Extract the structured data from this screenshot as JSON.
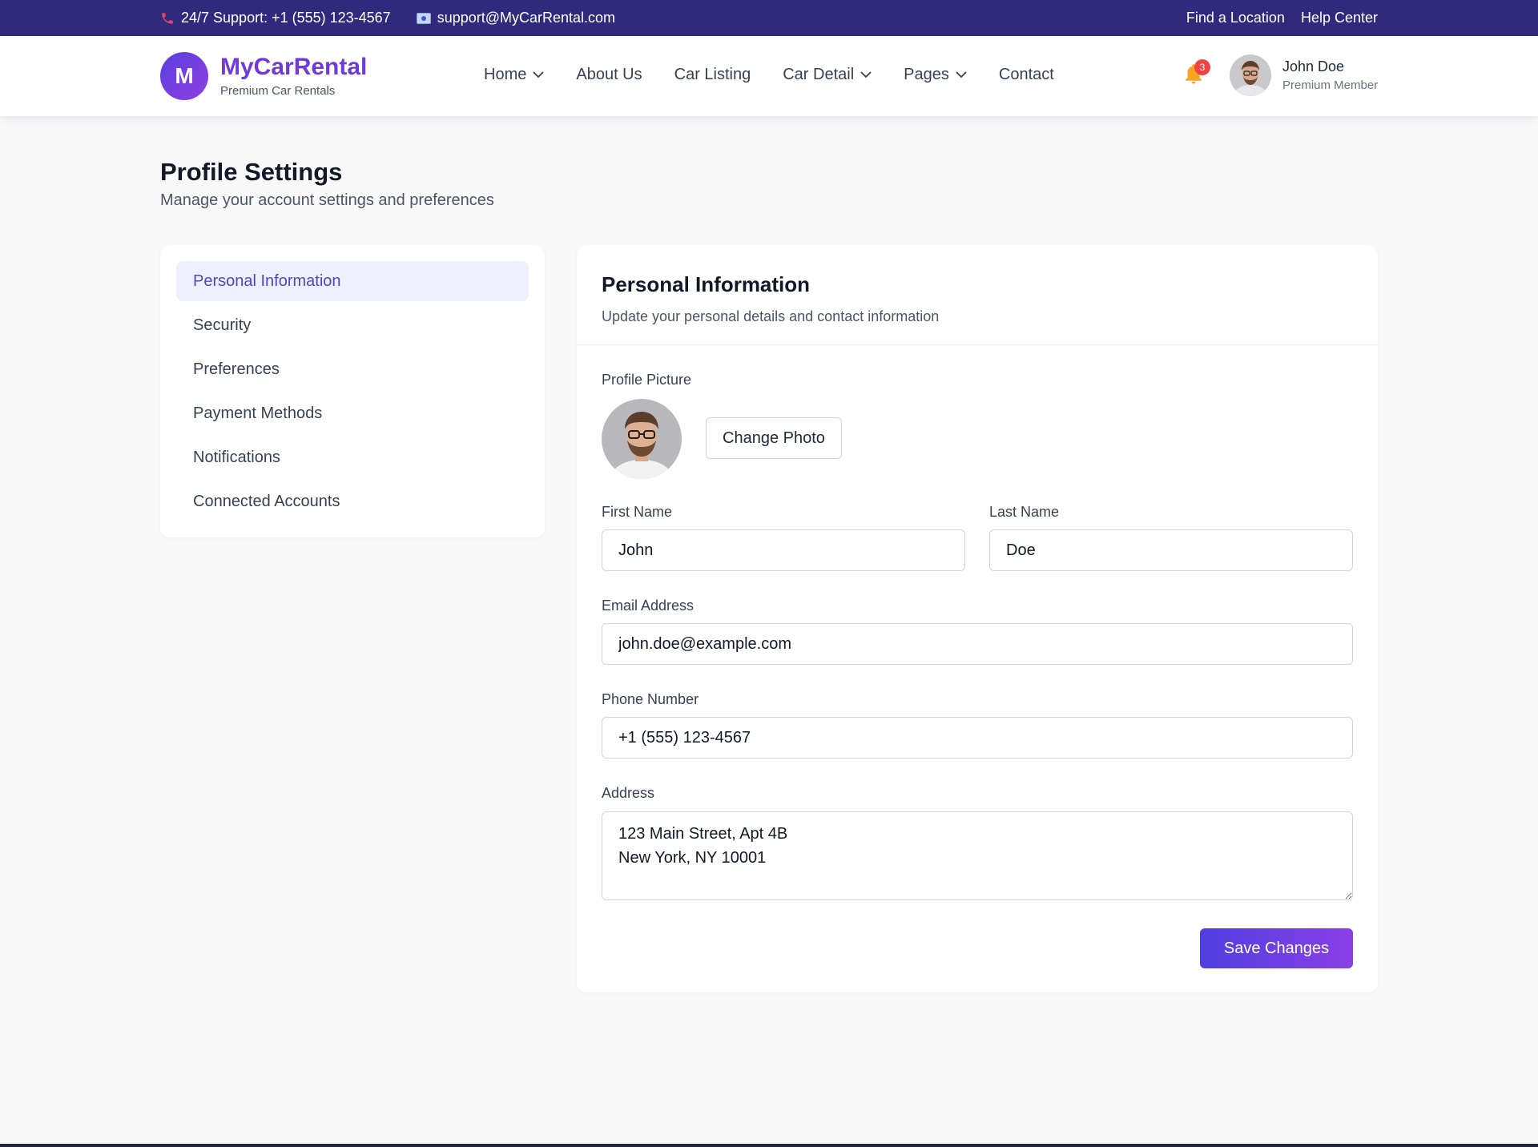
{
  "topbar": {
    "support_text": "24/7 Support: +1 (555) 123-4567",
    "email_text": "support@MyCarRental.com",
    "links": [
      "Find a Location",
      "Help Center"
    ],
    "phone_icon": "phone-icon",
    "mail_icon": "mail-icon"
  },
  "header": {
    "logo_letter": "M",
    "brand_name": "MyCarRental",
    "brand_tagline": "Premium Car Rentals",
    "nav": [
      {
        "label": "Home",
        "dropdown": true
      },
      {
        "label": "About Us",
        "dropdown": false
      },
      {
        "label": "Car Listing",
        "dropdown": false
      },
      {
        "label": "Car Detail",
        "dropdown": true
      },
      {
        "label": "Pages",
        "dropdown": true
      },
      {
        "label": "Contact",
        "dropdown": false
      }
    ],
    "notification_count": "3",
    "user_name": "John Doe",
    "user_role": "Premium Member"
  },
  "page": {
    "title": "Profile Settings",
    "subtitle": "Manage your account settings and preferences"
  },
  "sidebar": {
    "items": [
      {
        "label": "Personal Information",
        "active": true
      },
      {
        "label": "Security",
        "active": false
      },
      {
        "label": "Preferences",
        "active": false
      },
      {
        "label": "Payment Methods",
        "active": false
      },
      {
        "label": "Notifications",
        "active": false
      },
      {
        "label": "Connected Accounts",
        "active": false
      }
    ]
  },
  "form": {
    "title": "Personal Information",
    "subtitle": "Update your personal details and contact information",
    "profile_picture_label": "Profile Picture",
    "change_photo_label": "Change Photo",
    "first_name_label": "First Name",
    "first_name_value": "John",
    "last_name_label": "Last Name",
    "last_name_value": "Doe",
    "email_label": "Email Address",
    "email_value": "john.doe@example.com",
    "phone_label": "Phone Number",
    "phone_value": "+1 (555) 123-4567",
    "address_label": "Address",
    "address_value": "123 Main Street, Apt 4B\nNew York, NY 10001",
    "save_label": "Save Changes"
  },
  "colors": {
    "topbar_bg": "#302a7d",
    "brand": "#6f3ad8",
    "accent": "#4f46c4",
    "badge": "#ef4444",
    "active_bg": "#eef0fd"
  }
}
